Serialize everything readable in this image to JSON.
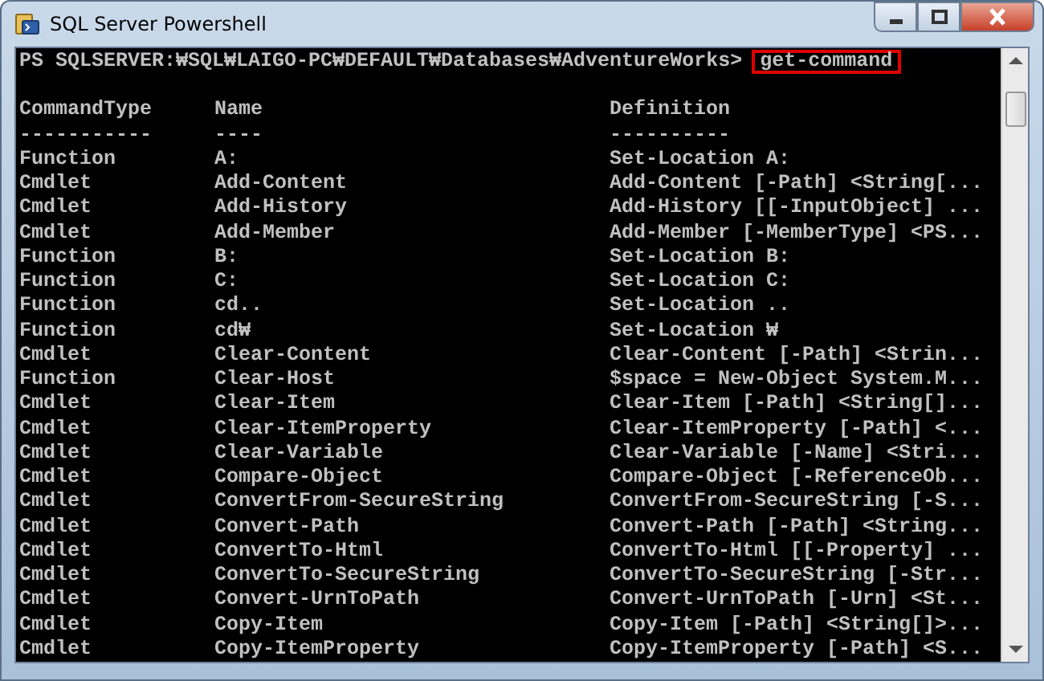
{
  "window": {
    "title": "SQL Server Powershell"
  },
  "console": {
    "prompt": "PS SQLSERVER:₩SQL₩LAIGO-PC₩DEFAULT₩Databases₩AdventureWorks>",
    "command": "get-command",
    "columns": [
      {
        "heading": "CommandType",
        "rule": "-----------"
      },
      {
        "heading": "Name",
        "rule": "----"
      },
      {
        "heading": "Definition",
        "rule": "----------"
      }
    ],
    "rows": [
      [
        "Function",
        "A:",
        "Set-Location A:"
      ],
      [
        "Cmdlet",
        "Add-Content",
        "Add-Content [-Path] <String[..."
      ],
      [
        "Cmdlet",
        "Add-History",
        "Add-History [[-InputObject] ..."
      ],
      [
        "Cmdlet",
        "Add-Member",
        "Add-Member [-MemberType] <PS..."
      ],
      [
        "Function",
        "B:",
        "Set-Location B:"
      ],
      [
        "Function",
        "C:",
        "Set-Location C:"
      ],
      [
        "Function",
        "cd..",
        "Set-Location .."
      ],
      [
        "Function",
        "cd₩",
        "Set-Location ₩"
      ],
      [
        "Cmdlet",
        "Clear-Content",
        "Clear-Content [-Path] <Strin..."
      ],
      [
        "Function",
        "Clear-Host",
        "$space = New-Object System.M..."
      ],
      [
        "Cmdlet",
        "Clear-Item",
        "Clear-Item [-Path] <String[]..."
      ],
      [
        "Cmdlet",
        "Clear-ItemProperty",
        "Clear-ItemProperty [-Path] <..."
      ],
      [
        "Cmdlet",
        "Clear-Variable",
        "Clear-Variable [-Name] <Stri..."
      ],
      [
        "Cmdlet",
        "Compare-Object",
        "Compare-Object [-ReferenceOb..."
      ],
      [
        "Cmdlet",
        "ConvertFrom-SecureString",
        "ConvertFrom-SecureString [-S..."
      ],
      [
        "Cmdlet",
        "Convert-Path",
        "Convert-Path [-Path] <String..."
      ],
      [
        "Cmdlet",
        "ConvertTo-Html",
        "ConvertTo-Html [[-Property] ..."
      ],
      [
        "Cmdlet",
        "ConvertTo-SecureString",
        "ConvertTo-SecureString [-Str..."
      ],
      [
        "Cmdlet",
        "Convert-UrnToPath",
        "Convert-UrnToPath [-Urn] <St..."
      ],
      [
        "Cmdlet",
        "Copy-Item",
        "Copy-Item [-Path] <String[]>..."
      ],
      [
        "Cmdlet",
        "Copy-ItemProperty",
        "Copy-ItemProperty [-Path] <S..."
      ]
    ]
  }
}
